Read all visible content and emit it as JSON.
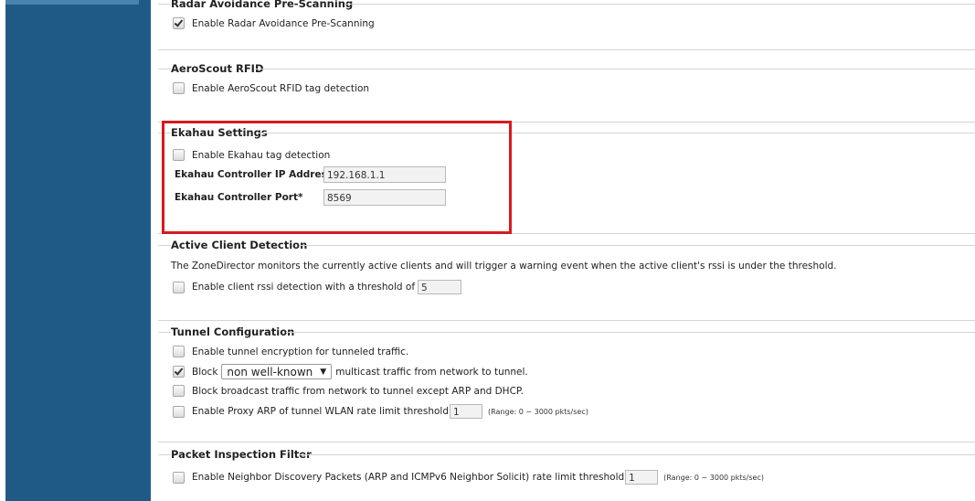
{
  "sections": {
    "radar": {
      "title": "Radar Avoidance Pre-Scanning",
      "enable_label": "Enable Radar Avoidance Pre-Scanning",
      "enabled": true
    },
    "aeroscout": {
      "title": "AeroScout RFID",
      "enable_label": "Enable AeroScout RFID tag detection",
      "enabled": false
    },
    "ekahau": {
      "title": "Ekahau Settings",
      "enable_label": "Enable Ekahau tag detection",
      "enabled": false,
      "ip_label": "Ekahau Controller IP Address*",
      "ip_value": "192.168.1.1",
      "port_label": "Ekahau Controller Port*",
      "port_value": "8569"
    },
    "active_client": {
      "title": "Active Client Detection",
      "description": "The ZoneDirector monitors the currently active clients and will trigger a warning event when the active client's rssi is under the threshold.",
      "enable_label": "Enable client rssi detection with a threshold of",
      "threshold": "5",
      "enabled": false
    },
    "tunnel": {
      "title": "Tunnel Configuration",
      "encryption_label": "Enable tunnel encryption for tunneled traffic.",
      "encryption_enabled": false,
      "block_label": "Block",
      "block_select": "non well-known",
      "block_suffix": "multicast traffic from network to tunnel.",
      "block_enabled": true,
      "broadcast_label": "Block broadcast traffic from network to tunnel except ARP and DHCP.",
      "broadcast_enabled": false,
      "proxy_label": "Enable Proxy ARP of tunnel WLAN rate limit threshold",
      "proxy_value": "1",
      "proxy_range": "(Range: 0 ~ 3000 pkts/sec)",
      "proxy_enabled": false
    },
    "packet": {
      "title": "Packet Inspection Filter",
      "nd_label": "Enable Neighbor Discovery Packets (ARP and ICMPv6 Neighbor Solicit) rate limit threshold",
      "nd_value": "1",
      "nd_range": "(Range: 0 ~ 3000 pkts/sec)",
      "nd_enabled": false
    }
  },
  "colors": {
    "sidebar": "#1f5a86",
    "highlight": "#d71920"
  }
}
